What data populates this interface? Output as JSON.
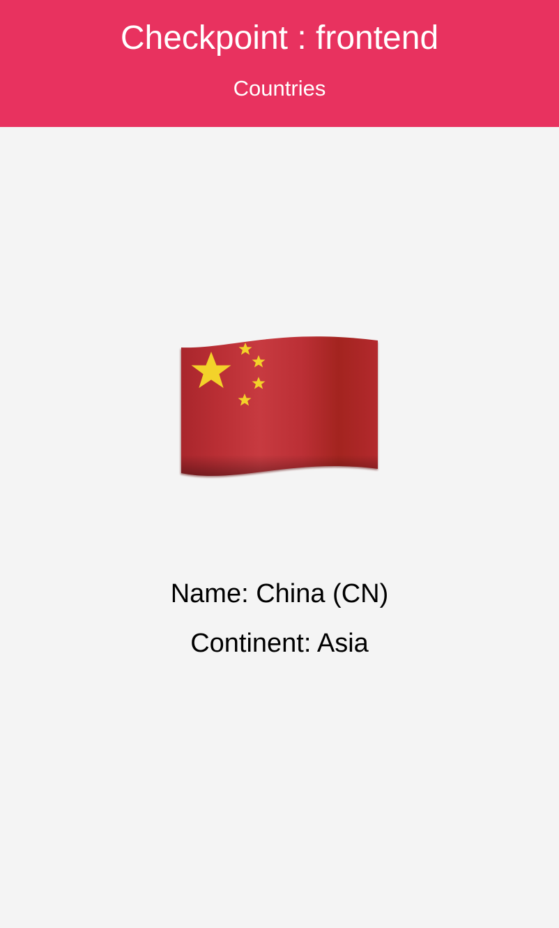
{
  "header": {
    "title": "Checkpoint : frontend",
    "nav_link": "Countries",
    "background_color": "#e8325f"
  },
  "country": {
    "flag_icon": "china-flag-icon",
    "name_line": "Name: China (CN)",
    "continent_line": "Continent: Asia"
  },
  "colors": {
    "page_background": "#f4f4f4",
    "flag_red": "#c1303a",
    "flag_star": "#f3d22a"
  }
}
